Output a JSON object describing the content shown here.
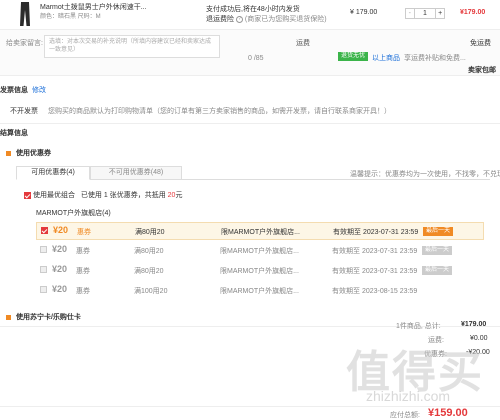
{
  "product": {
    "title": "Marmot土拨鼠男士户外休闲速干...",
    "attrs": "颜色：暗石黑  尺码：M",
    "promise_line1": "支付成功后,将在48小时内发货",
    "promise_line2": "退运费险",
    "promise_line2_note": "(商家已为您购买退货保险)",
    "unit_price": "¥ 179.00",
    "qty_minus": "-",
    "qty_value": "1",
    "qty_plus": "+",
    "subtotal": "¥179.00"
  },
  "message": {
    "label": "给卖家留言:",
    "placeholder": "选填：对本次交易的补充说明（所填内容建议已经和卖家达成一致意见）",
    "counter": "0 /85",
    "shipping_label": "运费",
    "shipping_value": "免运费",
    "delivery_badge": "退货无忧",
    "service_text": "以上商品",
    "service_tail": "享运费补贴和免费...",
    "seller_note": "卖家包邮"
  },
  "invoice": {
    "section_title": "发票信息",
    "edit_link": "修改",
    "type": "不开发票",
    "note": "您购买的商品默认为打印购物清单（您的订单有第三方卖家销售的商品，如需开发票，请自行联系商家开具！）"
  },
  "checkout": {
    "section_title": "结算信息"
  },
  "coupons": {
    "title": "使用优惠券",
    "tabs": [
      "可用优惠券(4)",
      "不可用优惠券(48)"
    ],
    "tip": "温馨提示：优惠券均为一次使用，不找零，不兑现",
    "best_combo": "使用最优组合",
    "best_combo_note": "已使用 1 张优惠券，共抵用",
    "best_combo_amount": "20",
    "best_combo_unit": "元",
    "store": "MARMOT户外旗舰店(4)",
    "rows": [
      {
        "value": "¥20",
        "type": "惠券",
        "rule": "满80用20",
        "scope": "限MARMOT户外旗舰店...",
        "expiry": "有效期至 2023-07-31 23:59",
        "badge": "最后一天",
        "checked": true
      },
      {
        "value": "¥20",
        "type": "惠券",
        "rule": "满80用20",
        "scope": "限MARMOT户外旗舰店...",
        "expiry": "有效期至 2023-07-31 23:59",
        "badge": "最后一天",
        "checked": false
      },
      {
        "value": "¥20",
        "type": "惠券",
        "rule": "满80用20",
        "scope": "限MARMOT户外旗舰店...",
        "expiry": "有效期至 2023-07-31 23:59",
        "badge": "最后一天",
        "checked": false
      },
      {
        "value": "¥20",
        "type": "惠券",
        "rule": "满100用20",
        "scope": "限MARMOT户外旗舰店...",
        "expiry": "有效期至 2023-08-15 23:59",
        "badge": "",
        "checked": false
      }
    ]
  },
  "card": {
    "title": "使用苏宁卡/乐购仕卡"
  },
  "summary": {
    "count_text": "1件商品, 总计:",
    "total": "¥179.00",
    "shipping_label": "运费:",
    "shipping": "¥0.00",
    "coupon_label": "优惠券:",
    "coupon": "-¥20.00",
    "pay_label": "应付总额:",
    "pay": "¥159.00"
  },
  "watermark": {
    "cn": "值得买",
    "url": "zhizhizhi.com"
  },
  "colors": {
    "accent": "#e4393c",
    "orange": "#f08a24",
    "green": "#3bb44a",
    "highlight_row": "#fdf6e6"
  }
}
